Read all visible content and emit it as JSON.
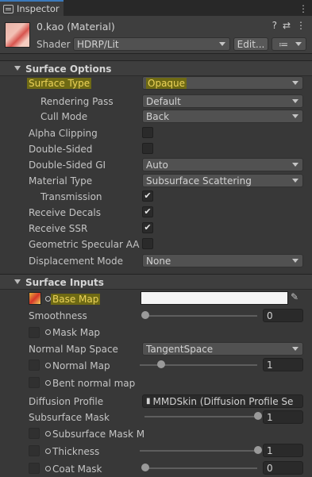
{
  "tab": {
    "label": "Inspector"
  },
  "material": {
    "name": "0.kao (Material)",
    "shader_label": "Shader",
    "shader_value": "HDRP/Lit",
    "edit_label": "Edit...",
    "list_icon": "≔"
  },
  "header_icons": {
    "help": "?",
    "preset": "⇄",
    "more": "⋮"
  },
  "surface_options": {
    "title": "Surface Options",
    "surface_type": {
      "label": "Surface Type",
      "value": "Opaque"
    },
    "rendering_pass": {
      "label": "Rendering Pass",
      "value": "Default"
    },
    "cull_mode": {
      "label": "Cull Mode",
      "value": "Back"
    },
    "alpha_clipping": {
      "label": "Alpha Clipping",
      "checked": false
    },
    "double_sided": {
      "label": "Double-Sided",
      "checked": false
    },
    "double_sided_gi": {
      "label": "Double-Sided GI",
      "value": "Auto"
    },
    "material_type": {
      "label": "Material Type",
      "value": "Subsurface Scattering"
    },
    "transmission": {
      "label": "Transmission",
      "checked": true,
      "mark": "✔"
    },
    "receive_decals": {
      "label": "Receive Decals",
      "checked": true,
      "mark": "✔"
    },
    "receive_ssr": {
      "label": "Receive SSR",
      "checked": true,
      "mark": "✔"
    },
    "geometric_specular_aa": {
      "label": "Geometric Specular AA",
      "checked": false
    },
    "displacement_mode": {
      "label": "Displacement Mode",
      "value": "None"
    }
  },
  "surface_inputs": {
    "title": "Surface Inputs",
    "base_map": {
      "label": "Base Map",
      "color": "#f4f4f4"
    },
    "smoothness": {
      "label": "Smoothness",
      "value": "0",
      "fraction": 0.0
    },
    "mask_map": {
      "label": "Mask Map"
    },
    "normal_map_space": {
      "label": "Normal Map Space",
      "value": "TangentSpace"
    },
    "normal_map": {
      "label": "Normal Map",
      "value": "1",
      "fraction": 0.14
    },
    "bent_normal_map": {
      "label": "Bent normal map"
    },
    "diffusion_profile": {
      "label": "Diffusion Profile",
      "value": "MMDSkin (Diffusion Profile Se"
    },
    "subsurface_mask": {
      "label": "Subsurface Mask",
      "value": "1",
      "fraction": 1.0
    },
    "subsurface_mask_map": {
      "label": "Subsurface Mask M"
    },
    "thickness": {
      "label": "Thickness",
      "value": "1",
      "fraction": 1.0
    },
    "coat_mask": {
      "label": "Coat Mask",
      "value": "0",
      "fraction": 0.0
    }
  }
}
